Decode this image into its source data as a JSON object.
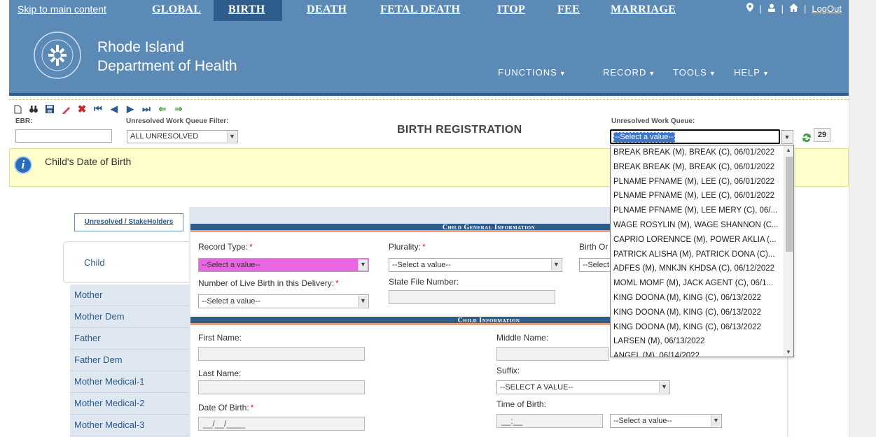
{
  "header": {
    "skip_link": "Skip to main content",
    "nav": [
      {
        "label": "GLOBAL"
      },
      {
        "label": "BIRTH"
      },
      {
        "label": "DEATH"
      },
      {
        "label": "FETAL DEATH"
      },
      {
        "label": "ITOP"
      },
      {
        "label": "FEE"
      },
      {
        "label": "MARRIAGE"
      }
    ],
    "logout": "LogOut",
    "org_line1": "Rhode Island",
    "org_line2": "Department of Health",
    "menu": [
      {
        "label": "FUNCTIONS"
      },
      {
        "label": "RECORD"
      },
      {
        "label": "TOOLS"
      },
      {
        "label": "HELP"
      }
    ],
    "accent_color": "#5b8ab6",
    "active_color": "#2e5d8c"
  },
  "toolbar": {
    "ebr_label": "EBR:",
    "ebr_value": "",
    "filter_label": "Unresolved Work Queue Filter:",
    "filter_value": "ALL UNRESOLVED",
    "title": "BIRTH REGISTRATION",
    "queue_label": "Unresolved Work Queue:",
    "queue_value": "--Select a value--",
    "count": "29"
  },
  "banner": {
    "text": "Child's Date of Birth"
  },
  "queue_options": [
    "BREAK BREAK (M), BREAK (C), 06/01/2022",
    "BREAK BREAK (M), BREAK (C), 06/01/2022",
    "PLNAME PFNAME (M), LEE (C), 06/01/2022",
    "PLNAME PFNAME (M), LEE (C), 06/01/2022",
    "PLNAME PFNAME (M), LEE MERY (C), 06/...",
    "WAGE ROSYLIN (M), WAGE SHANNON (C...",
    "CAPRIO LORENNCE (M), POWER AKLIA (...",
    "PATRICK ALISHA (M), PATRICK DONA (C)...",
    "ADFES (M), MNKJN KHDSA (C), 06/12/2022",
    "MOML MOMF (M), JACK AGENT (C), 06/1...",
    "KING DOONA (M), KING (C), 06/13/2022",
    "KING DOONA (M), KING (C), 06/13/2022",
    "KING DOONA (M), KING (C), 06/13/2022",
    "LARSEN (M), 06/13/2022",
    "ANGEL (M), 06/14/2022"
  ],
  "tabs": {
    "stakeholders": "Unresolved / StakeHolders",
    "active": "Child",
    "items": [
      {
        "label": "Mother"
      },
      {
        "label": "Mother Dem"
      },
      {
        "label": "Father"
      },
      {
        "label": "Father Dem"
      },
      {
        "label": "Mother Medical-1"
      },
      {
        "label": "Mother Medical-2"
      },
      {
        "label": "Mother Medical-3"
      }
    ]
  },
  "form": {
    "section1": "Child General Information",
    "record_type_label": "Record Type:",
    "record_type_value": "--Select a value--",
    "record_type_color": "#e866e0",
    "plurality_label": "Plurality:",
    "plurality_value": "--Select a value--",
    "birth_order_label": "Birth Or",
    "birth_order_value": "--Select",
    "live_birth_label": "Number of Live Birth in this Delivery:",
    "live_birth_value": "--Select a value--",
    "state_file_label": "State File Number:",
    "section2": "Child Information",
    "first_name_label": "First Name:",
    "middle_name_label": "Middle Name:",
    "last_name_label": "Last Name:",
    "suffix_label": "Suffix:",
    "suffix_value": "--SELECT A VALUE--",
    "dob_label": "Date Of Birth:",
    "dob_value": "__/__/____",
    "tob_label": "Time of Birth:",
    "tob_value": "__:__",
    "tob_ampm_value": "--Select a value--"
  }
}
